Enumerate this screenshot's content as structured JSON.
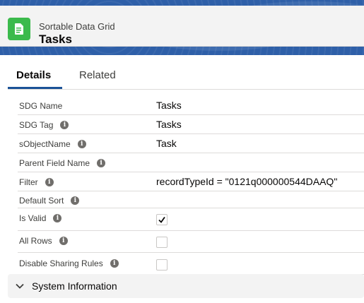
{
  "header": {
    "object_label": "Sortable Data Grid",
    "record_title": "Tasks",
    "icon": "record-icon",
    "icon_color": "#3bba4c"
  },
  "tabs": [
    {
      "label": "Details",
      "active": true
    },
    {
      "label": "Related",
      "active": false
    }
  ],
  "fields": [
    {
      "label": "SDG Name",
      "value": "Tasks",
      "info": false
    },
    {
      "label": "SDG Tag",
      "value": "Tasks",
      "info": true
    },
    {
      "label": "sObjectName",
      "value": "Task",
      "info": true
    },
    {
      "label": "Parent Field Name",
      "value": "",
      "info": true
    },
    {
      "label": "Filter",
      "value": "recordTypeId = \"0121q000000544DAAQ\"",
      "info": true
    },
    {
      "label": "Default Sort",
      "value": "",
      "info": true
    },
    {
      "label": "Is Valid",
      "checked": true,
      "info": true
    },
    {
      "label": "All Rows",
      "checked": false,
      "info": true
    },
    {
      "label": "Disable Sharing Rules",
      "checked": false,
      "info": true
    }
  ],
  "info_glyph": "i",
  "section": {
    "label": "System Information",
    "icon": "chevron-down-icon"
  },
  "colors": {
    "brand": "#1b5297",
    "header_bg": "#2e5fa8"
  }
}
